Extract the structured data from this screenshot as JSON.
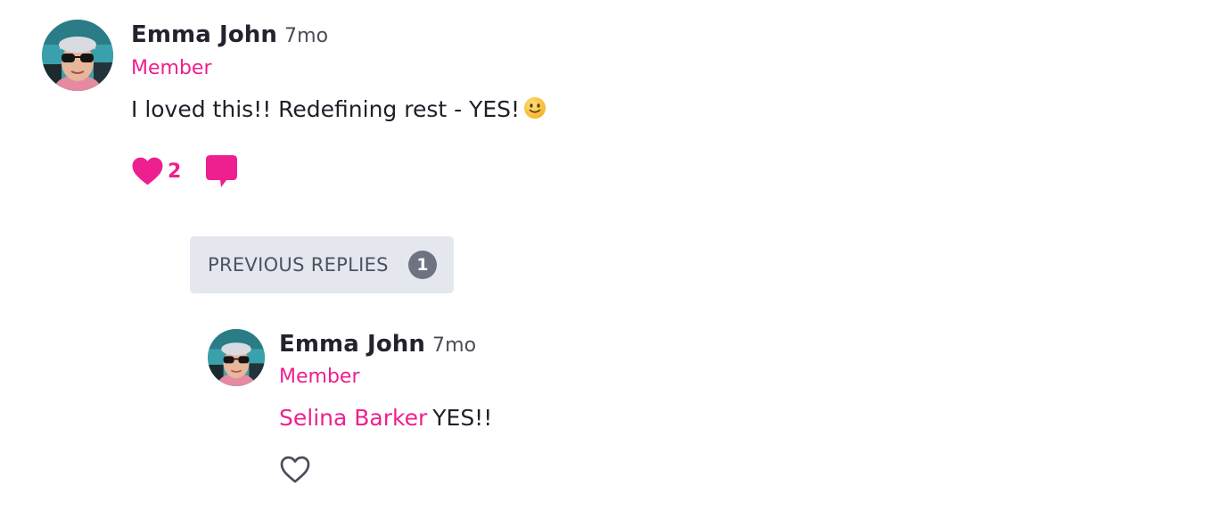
{
  "comment": {
    "author": "Emma John",
    "time": "7mo",
    "role": "Member",
    "text": "I loved this!! Redefining rest - YES!",
    "emoji": "slightly-smiling-face",
    "like_count": "2",
    "icons": {
      "like": "heart-filled-icon",
      "reply": "comment-bubble-icon"
    }
  },
  "previous_replies": {
    "label": "PREVIOUS REPLIES",
    "count": "1"
  },
  "reply": {
    "author": "Emma John",
    "time": "7mo",
    "role": "Member",
    "mention": "Selina Barker",
    "text": "YES!!",
    "icons": {
      "like": "heart-outline-icon"
    }
  },
  "colors": {
    "accent": "#ee1f8f",
    "text": "#1f1f29",
    "muted": "#4b4b57",
    "button_bg": "#e5e7ef",
    "badge_bg": "#6e7281"
  }
}
